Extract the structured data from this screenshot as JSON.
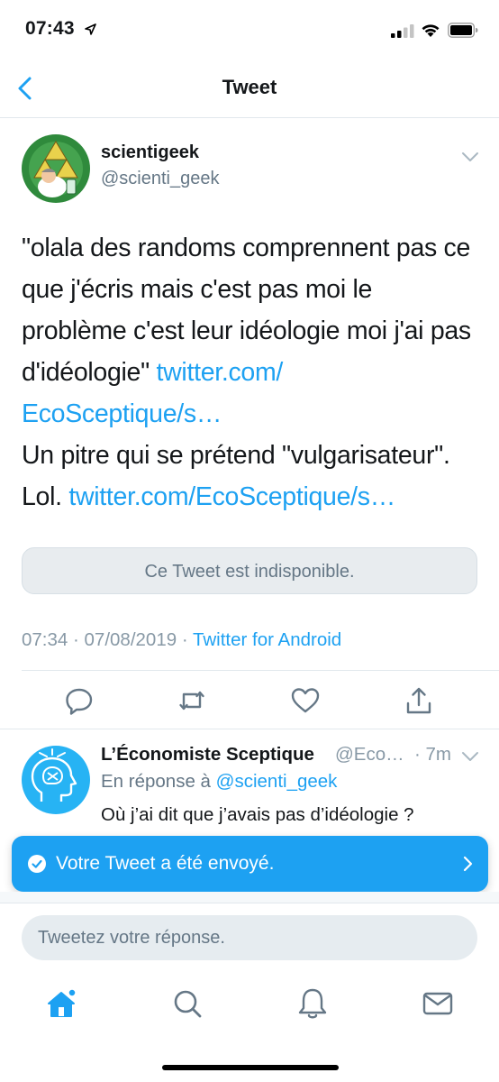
{
  "status_bar": {
    "time": "07:43"
  },
  "nav": {
    "title": "Tweet"
  },
  "tweet": {
    "display_name": "scientigeek",
    "handle": "@scienti_geek",
    "text_1": "\"olala des randoms comprennent pas ce que j'écris mais c'est pas moi le problème c'est leur idéologie moi j'ai pas d'idéologie\" ",
    "link_1": "twitter.com/ EcoSceptique/s…",
    "text_2": "Un pitre qui se prétend \"vulgarisateur\". Lol. ",
    "link_2": "twitter.com/EcoSceptique/s…",
    "quoted_unavailable": "Ce Tweet est indisponible.",
    "timestamp": "07:34 · 07/08/2019 · ",
    "client": "Twitter for Android"
  },
  "actions": [
    "reply-icon",
    "retweet-icon",
    "like-icon",
    "share-icon"
  ],
  "reply": {
    "display_name": "L’Économiste Sceptique",
    "handle": "@Eco…",
    "time": "· 7m",
    "reply_to_prefix": "En réponse à ",
    "reply_to_handle": "@scienti_geek",
    "text": "Où j’ai dit que j’avais pas d’idéologie ?"
  },
  "toast": {
    "text": "Votre Tweet a été envoyé."
  },
  "compose": {
    "placeholder": "Tweetez votre réponse."
  },
  "tab_bar": [
    "home-icon",
    "search-icon",
    "notifications-icon",
    "messages-icon"
  ],
  "colors": {
    "accent": "#1da1f2",
    "text": "#14171a",
    "secondary": "#657786",
    "divider": "#e1e8ed"
  }
}
